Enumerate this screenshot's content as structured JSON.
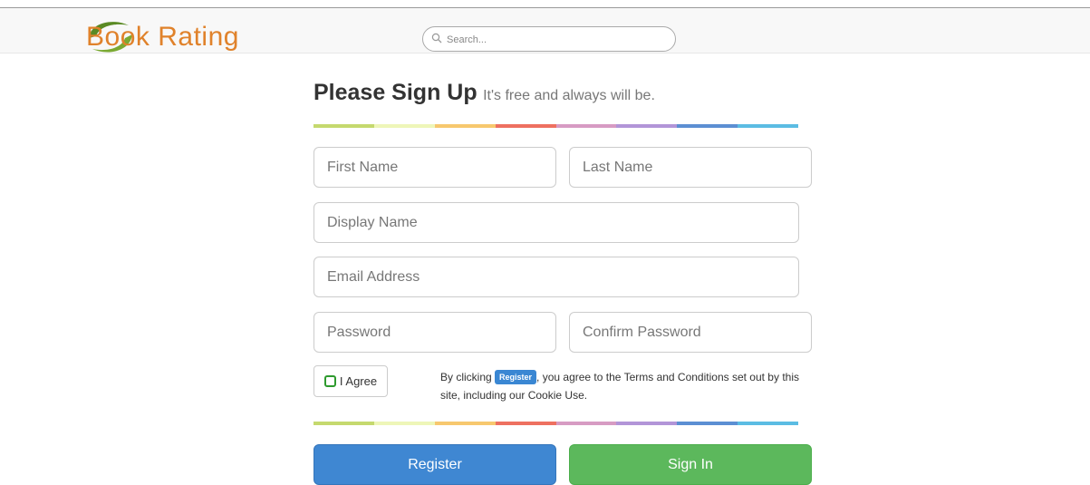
{
  "brand": {
    "name": "Book Rating"
  },
  "search": {
    "placeholder": "Search..."
  },
  "heading": {
    "title": "Please Sign Up",
    "subtitle": "It's free and always will be."
  },
  "form": {
    "first_name_placeholder": "First Name",
    "last_name_placeholder": "Last Name",
    "display_name_placeholder": "Display Name",
    "email_placeholder": "Email Address",
    "password_placeholder": "Password",
    "confirm_password_placeholder": "Confirm Password"
  },
  "agree": {
    "label": "I Agree"
  },
  "terms": {
    "before": "By clicking ",
    "badge": "Register",
    "after": ", you agree to the Terms and Conditions set out by this site, including our Cookie Use."
  },
  "buttons": {
    "register": "Register",
    "sign_in": "Sign In"
  },
  "colors": {
    "brand": "#e0822b",
    "primary": "#3f87d2",
    "success": "#5cb85c",
    "rainbow": [
      "#c5d96e",
      "#eef6b8",
      "#f7c86e",
      "#ee7060",
      "#d79bc3",
      "#b295d8",
      "#5c8fd3",
      "#5bbce3"
    ]
  }
}
